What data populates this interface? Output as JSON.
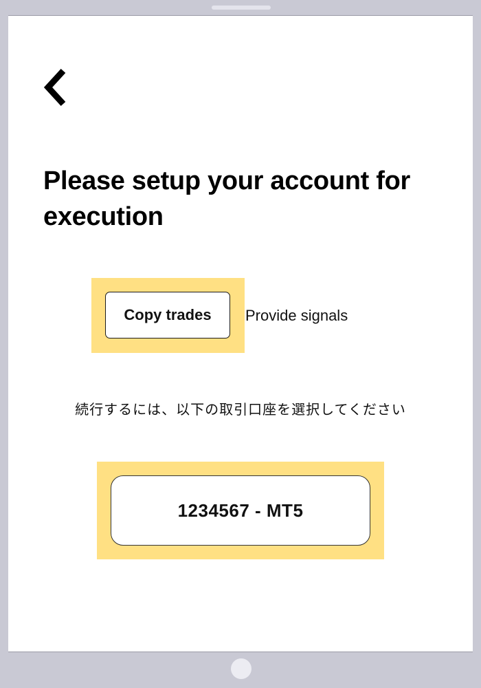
{
  "nav": {
    "back_icon": "chevron-left-icon"
  },
  "header": {
    "title": "Please setup your account for execution"
  },
  "mode_tabs": {
    "copy_trades_label": "Copy trades",
    "provide_signals_label": "Provide signals",
    "selected": "Copy trades"
  },
  "instruction": {
    "text": "続行するには、以下の取引口座を選択してください"
  },
  "accounts": [
    {
      "label": "1234567 - MT5"
    }
  ],
  "colors": {
    "highlight": "#ffe083",
    "frame": "#c9c9d4",
    "screen": "#ffffff"
  }
}
